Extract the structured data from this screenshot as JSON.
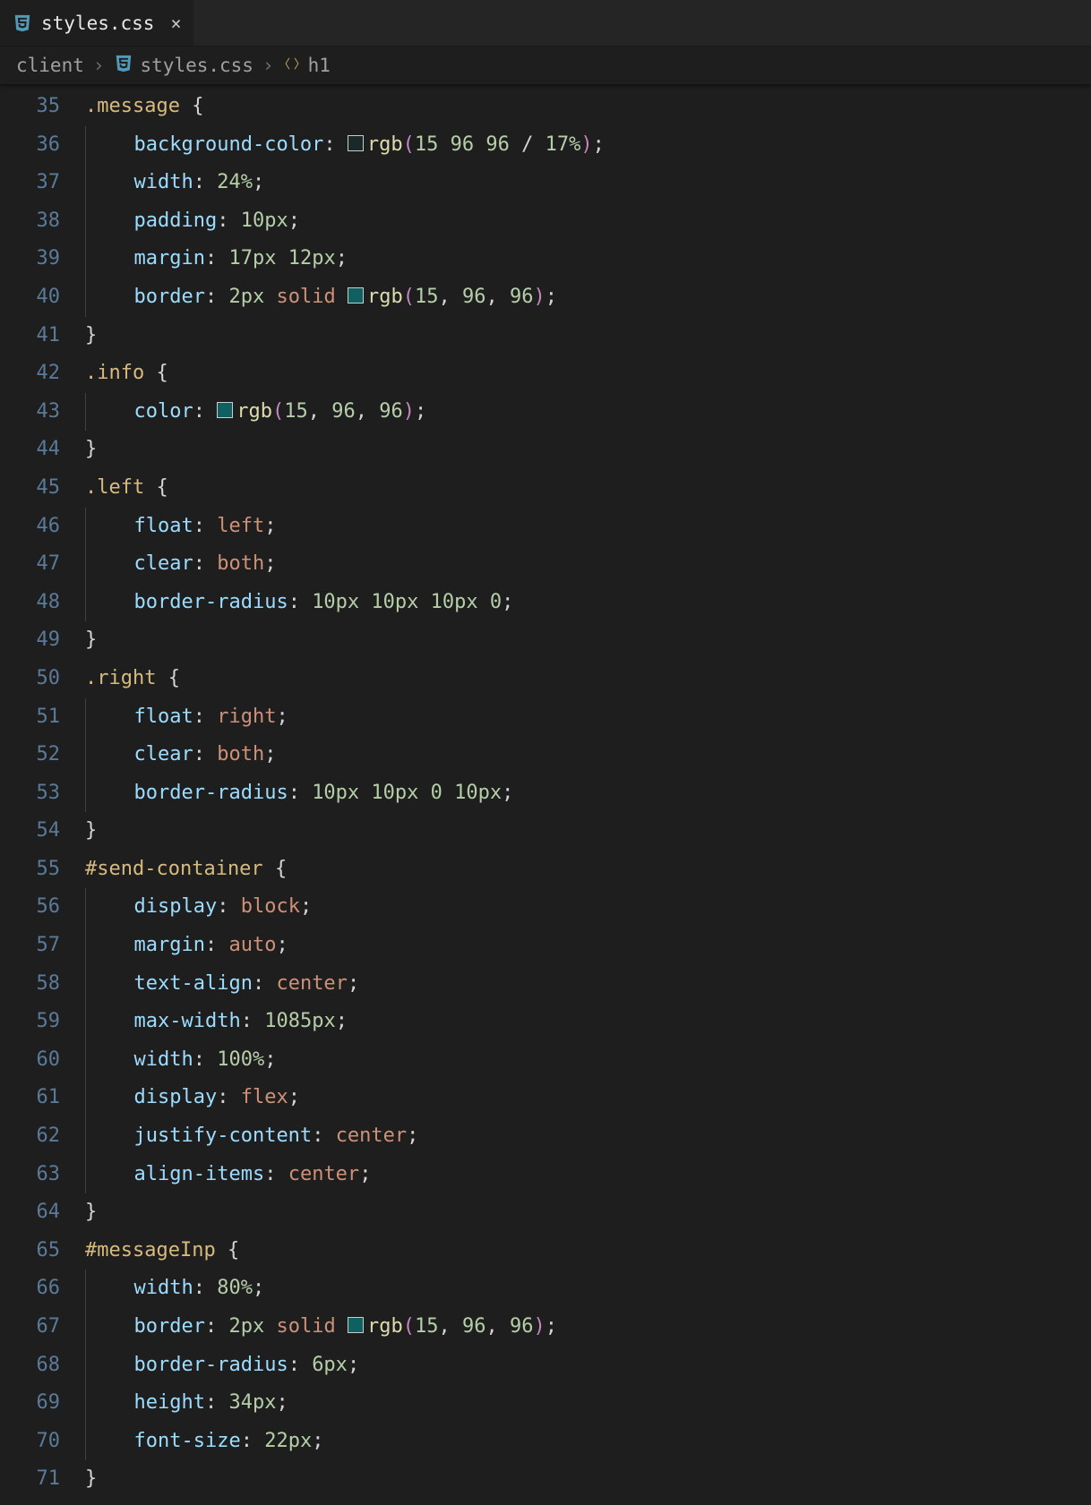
{
  "tab": {
    "filename": "styles.css",
    "close_glyph": "×"
  },
  "breadcrumbs": {
    "folder": "client",
    "file": "styles.css",
    "symbol": "h1"
  },
  "line_start": 35,
  "line_end": 71,
  "code_lines": [
    {
      "n": 35,
      "i": 0,
      "html": "<span class='sel'>.message</span> <span class='brace'>{</span>"
    },
    {
      "n": 36,
      "i": 1,
      "html": "<span class='prop'>background-color</span><span class='punct'>:</span> <span class='swatch' style='background:rgba(15,96,96,0.17)'></span><span class='fn'>rgb</span><span class='paren'>(</span><span class='num'>15</span> <span class='num'>96</span> <span class='num'>96</span> <span class='punct'>/</span> <span class='num'>17%</span><span class='paren'>)</span><span class='punct'>;</span>"
    },
    {
      "n": 37,
      "i": 1,
      "html": "<span class='prop'>width</span><span class='punct'>:</span> <span class='num'>24%</span><span class='punct'>;</span>"
    },
    {
      "n": 38,
      "i": 1,
      "html": "<span class='prop'>padding</span><span class='punct'>:</span> <span class='num'>10px</span><span class='punct'>;</span>"
    },
    {
      "n": 39,
      "i": 1,
      "html": "<span class='prop'>margin</span><span class='punct'>:</span> <span class='num'>17px</span> <span class='num'>12px</span><span class='punct'>;</span>"
    },
    {
      "n": 40,
      "i": 1,
      "html": "<span class='prop'>border</span><span class='punct'>:</span> <span class='num'>2px</span> <span class='val'>solid</span> <span class='swatch' style='background:rgb(15,96,96)'></span><span class='fn'>rgb</span><span class='paren'>(</span><span class='num'>15</span><span class='punct'>,</span> <span class='num'>96</span><span class='punct'>,</span> <span class='num'>96</span><span class='paren'>)</span><span class='punct'>;</span>"
    },
    {
      "n": 41,
      "i": 0,
      "html": "<span class='brace'>}</span>"
    },
    {
      "n": 42,
      "i": 0,
      "html": "<span class='sel'>.info</span> <span class='brace'>{</span>"
    },
    {
      "n": 43,
      "i": 1,
      "html": "<span class='prop'>color</span><span class='punct'>:</span> <span class='swatch' style='background:rgb(15,96,96)'></span><span class='fn'>rgb</span><span class='paren'>(</span><span class='num'>15</span><span class='punct'>,</span> <span class='num'>96</span><span class='punct'>,</span> <span class='num'>96</span><span class='paren'>)</span><span class='punct'>;</span>"
    },
    {
      "n": 44,
      "i": 0,
      "html": "<span class='brace'>}</span>"
    },
    {
      "n": 45,
      "i": 0,
      "html": "<span class='sel'>.left</span> <span class='brace'>{</span>"
    },
    {
      "n": 46,
      "i": 1,
      "html": "<span class='prop'>float</span><span class='punct'>:</span> <span class='val'>left</span><span class='punct'>;</span>"
    },
    {
      "n": 47,
      "i": 1,
      "html": "<span class='prop'>clear</span><span class='punct'>:</span> <span class='val'>both</span><span class='punct'>;</span>"
    },
    {
      "n": 48,
      "i": 1,
      "html": "<span class='prop'>border-radius</span><span class='punct'>:</span> <span class='num'>10px</span> <span class='num'>10px</span> <span class='num'>10px</span> <span class='num'>0</span><span class='punct'>;</span>"
    },
    {
      "n": 49,
      "i": 0,
      "html": "<span class='brace'>}</span>"
    },
    {
      "n": 50,
      "i": 0,
      "html": "<span class='sel'>.right</span> <span class='brace'>{</span>"
    },
    {
      "n": 51,
      "i": 1,
      "html": "<span class='prop'>float</span><span class='punct'>:</span> <span class='val'>right</span><span class='punct'>;</span>"
    },
    {
      "n": 52,
      "i": 1,
      "html": "<span class='prop'>clear</span><span class='punct'>:</span> <span class='val'>both</span><span class='punct'>;</span>"
    },
    {
      "n": 53,
      "i": 1,
      "html": "<span class='prop'>border-radius</span><span class='punct'>:</span> <span class='num'>10px</span> <span class='num'>10px</span> <span class='num'>0</span> <span class='num'>10px</span><span class='punct'>;</span>"
    },
    {
      "n": 54,
      "i": 0,
      "html": "<span class='brace'>}</span>"
    },
    {
      "n": 55,
      "i": 0,
      "html": "<span class='sel'>#send-container</span> <span class='brace'>{</span>"
    },
    {
      "n": 56,
      "i": 1,
      "html": "<span class='prop'>display</span><span class='punct'>:</span> <span class='val'>block</span><span class='punct'>;</span>"
    },
    {
      "n": 57,
      "i": 1,
      "html": "<span class='prop'>margin</span><span class='punct'>:</span> <span class='val'>auto</span><span class='punct'>;</span>"
    },
    {
      "n": 58,
      "i": 1,
      "html": "<span class='prop'>text-align</span><span class='punct'>:</span> <span class='val'>center</span><span class='punct'>;</span>"
    },
    {
      "n": 59,
      "i": 1,
      "html": "<span class='prop'>max-width</span><span class='punct'>:</span> <span class='num'>1085px</span><span class='punct'>;</span>"
    },
    {
      "n": 60,
      "i": 1,
      "html": "<span class='prop'>width</span><span class='punct'>:</span> <span class='num'>100%</span><span class='punct'>;</span>"
    },
    {
      "n": 61,
      "i": 1,
      "html": "<span class='prop'>display</span><span class='punct'>:</span> <span class='val'>flex</span><span class='punct'>;</span>"
    },
    {
      "n": 62,
      "i": 1,
      "html": "<span class='prop'>justify-content</span><span class='punct'>:</span> <span class='val'>center</span><span class='punct'>;</span>"
    },
    {
      "n": 63,
      "i": 1,
      "html": "<span class='prop'>align-items</span><span class='punct'>:</span> <span class='val'>center</span><span class='punct'>;</span>"
    },
    {
      "n": 64,
      "i": 0,
      "html": "<span class='brace'>}</span>"
    },
    {
      "n": 65,
      "i": 0,
      "html": "<span class='sel'>#messageInp</span> <span class='brace'>{</span>"
    },
    {
      "n": 66,
      "i": 1,
      "html": "<span class='prop'>width</span><span class='punct'>:</span> <span class='num'>80%</span><span class='punct'>;</span>"
    },
    {
      "n": 67,
      "i": 1,
      "html": "<span class='prop'>border</span><span class='punct'>:</span> <span class='num'>2px</span> <span class='val'>solid</span> <span class='swatch' style='background:rgb(15,96,96)'></span><span class='fn'>rgb</span><span class='paren'>(</span><span class='num'>15</span><span class='punct'>,</span> <span class='num'>96</span><span class='punct'>,</span> <span class='num'>96</span><span class='paren'>)</span><span class='punct'>;</span>"
    },
    {
      "n": 68,
      "i": 1,
      "html": "<span class='prop'>border-radius</span><span class='punct'>:</span> <span class='num'>6px</span><span class='punct'>;</span>"
    },
    {
      "n": 69,
      "i": 1,
      "html": "<span class='prop'>height</span><span class='punct'>:</span> <span class='num'>34px</span><span class='punct'>;</span>"
    },
    {
      "n": 70,
      "i": 1,
      "html": "<span class='prop'>font-size</span><span class='punct'>:</span> <span class='num'>22px</span><span class='punct'>;</span>"
    },
    {
      "n": 71,
      "i": 0,
      "html": "<span class='brace'>}</span>"
    }
  ],
  "colors": {
    "teal": "#0f6060",
    "teal_alpha": "rgba(15,96,96,0.17)"
  }
}
